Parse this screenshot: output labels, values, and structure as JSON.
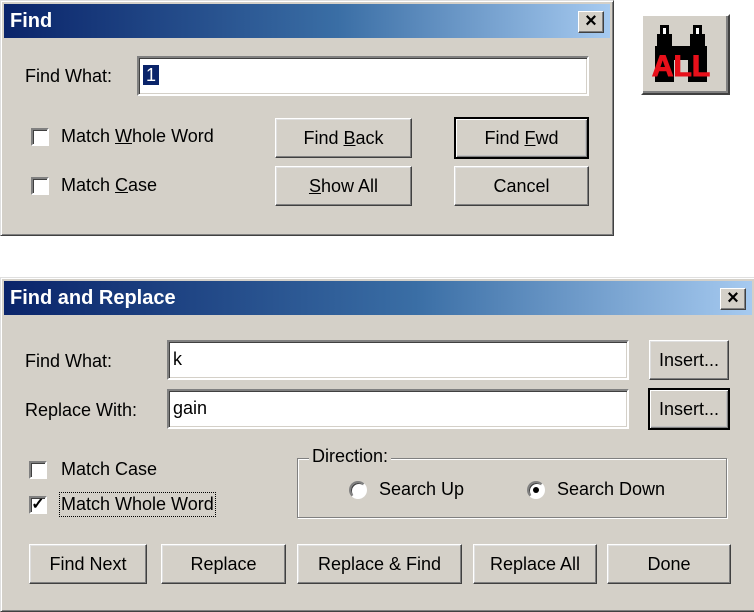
{
  "find_dialog": {
    "title": "Find",
    "close_glyph": "×",
    "find_what_label": "Find What:",
    "find_what_value": "1",
    "match_whole_word": {
      "pre": "Match ",
      "mnemonic": "W",
      "post": "hole Word",
      "checked": false
    },
    "match_case": {
      "pre": "Match ",
      "mnemonic": "C",
      "post": "ase",
      "checked": false
    },
    "find_back": {
      "pre": "Find ",
      "mnemonic": "B",
      "post": "ack"
    },
    "find_fwd": {
      "pre": "Find ",
      "mnemonic": "F",
      "post": "wd"
    },
    "show_all": {
      "pre": "",
      "mnemonic": "S",
      "post": "how All"
    },
    "cancel_label": "Cancel"
  },
  "toolbar_icon": {
    "name": "find-all-binoculars-icon",
    "text": "ALL",
    "text_color": "#e8101a"
  },
  "replace_dialog": {
    "title": "Find and Replace",
    "close_glyph": "×",
    "find_what_label": "Find What:",
    "find_what_value": "k",
    "replace_with_label": "Replace With:",
    "replace_with_value": "gain",
    "insert_label_1": "Insert...",
    "insert_label_2": "Insert...",
    "match_case": {
      "label": "Match Case",
      "checked": false
    },
    "match_whole_word": {
      "label": "Match Whole Word",
      "checked": true
    },
    "direction": {
      "legend": "Direction:",
      "search_up": {
        "label": "Search Up",
        "selected": false
      },
      "search_down": {
        "label": "Search Down",
        "selected": true
      }
    },
    "buttons": {
      "find_next": "Find Next",
      "replace": "Replace",
      "replace_find": "Replace & Find",
      "replace_all": "Replace All",
      "done": "Done"
    },
    "check_glyph": "✓"
  },
  "colors": {
    "dialog_face": "#d4d0c8",
    "title_start": "#0a246a",
    "title_end": "#a6caf0"
  }
}
